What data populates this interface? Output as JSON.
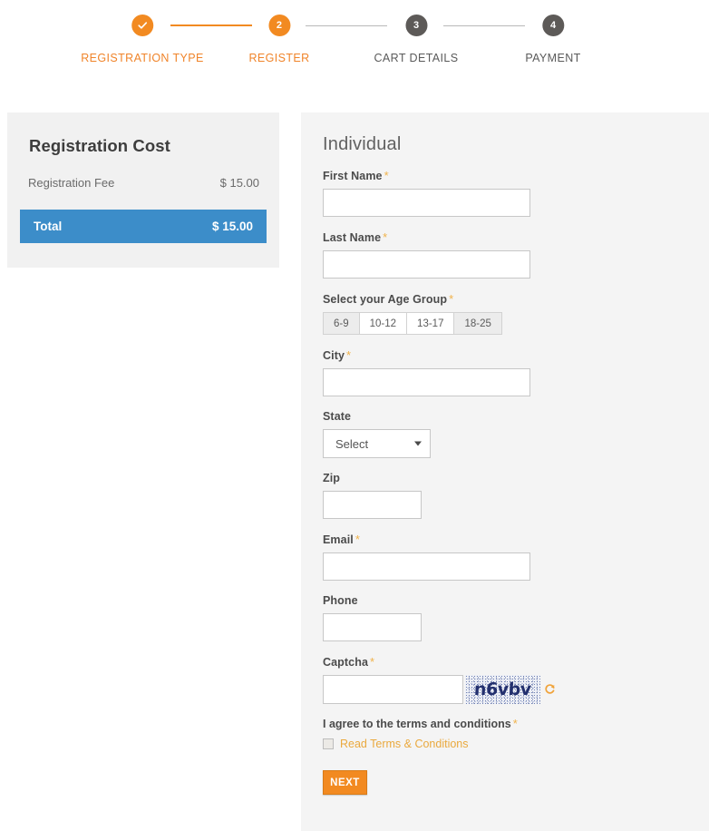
{
  "stepper": {
    "steps": [
      {
        "marker": "✓",
        "label": "REGISTRATION TYPE",
        "state": "done"
      },
      {
        "marker": "2",
        "label": "REGISTER",
        "state": "active"
      },
      {
        "marker": "3",
        "label": "CART DETAILS",
        "state": "todo"
      },
      {
        "marker": "4",
        "label": "PAYMENT",
        "state": "todo"
      }
    ]
  },
  "cost": {
    "title": "Registration Cost",
    "fee_label": "Registration Fee",
    "fee_value": "$ 15.00",
    "total_label": "Total",
    "total_value": "$ 15.00"
  },
  "form": {
    "title": "Individual",
    "first_name_label": "First Name",
    "last_name_label": "Last Name",
    "age_group_label": "Select your Age Group",
    "age_groups": [
      "6-9",
      "10-12",
      "13-17",
      "18-25"
    ],
    "city_label": "City",
    "state_label": "State",
    "state_selected": "Select",
    "zip_label": "Zip",
    "email_label": "Email",
    "phone_label": "Phone",
    "captcha_label": "Captcha",
    "captcha_text": "n6vbv",
    "terms_label": "I agree to the terms and conditions",
    "terms_link": "Read Terms & Conditions",
    "next_label": "NEXT",
    "required_mark": "*",
    "first_name_value": "",
    "last_name_value": "",
    "city_value": "",
    "zip_value": "",
    "email_value": "",
    "phone_value": "",
    "captcha_value": ""
  },
  "colors": {
    "accent_orange": "#f28a21",
    "total_blue": "#3c8dc9",
    "panel_gray": "#f4f4f4",
    "step_inactive": "#5d5a58",
    "required_star": "#f0b24a"
  }
}
